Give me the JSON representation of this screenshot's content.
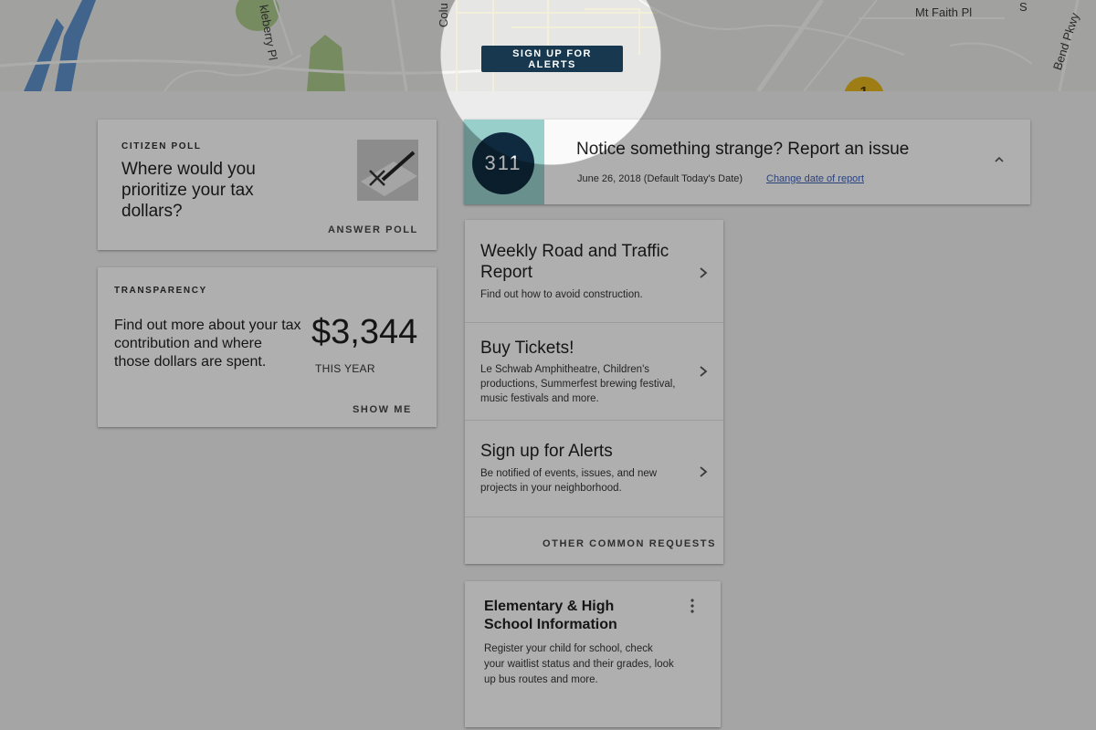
{
  "map": {
    "streets": [
      "kleberry Pl",
      "Colu",
      "Mt Faith Pl",
      "Bend Pkwy",
      "S"
    ],
    "marker_label": "1"
  },
  "spotlight": {
    "button_label": "SIGN UP FOR ALERTS"
  },
  "poll": {
    "overline": "CITIZEN POLL",
    "question": "Where would you prioritize your tax dollars?",
    "action": "ANSWER POLL"
  },
  "transparency": {
    "overline": "TRANSPARENCY",
    "description": "Find out more about your tax contribution and where those dollars are spent.",
    "amount": "$3,344",
    "amount_caption": "THIS YEAR",
    "action": "SHOW ME"
  },
  "notice": {
    "badge": "311",
    "title": "Notice something strange? Report an issue",
    "date": "June 26, 2018 (Default Today's Date)",
    "change_link": "Change date of report"
  },
  "services": {
    "items": [
      {
        "title": "Weekly Road and Traffic Report",
        "description": "Find out how to avoid construction."
      },
      {
        "title": "Buy Tickets!",
        "description": "Le Schwab Amphitheatre, Children's productions, Summerfest brewing festival, music festivals and more."
      },
      {
        "title": "Sign up for Alerts",
        "description": "Be notified of events, issues, and new projects in your neighborhood."
      }
    ],
    "action": "OTHER COMMON REQUESTS"
  },
  "school": {
    "title": "Elementary & High School Information",
    "description": "Register your child for school, check your waitlist status and their grades, look up bus routes and more."
  },
  "colors": {
    "badge_bg": "#0f2a3e",
    "stripe": "#98cfca",
    "button_bg": "#17384f",
    "link": "#3d5fb0",
    "marker": "#e3b51c"
  }
}
